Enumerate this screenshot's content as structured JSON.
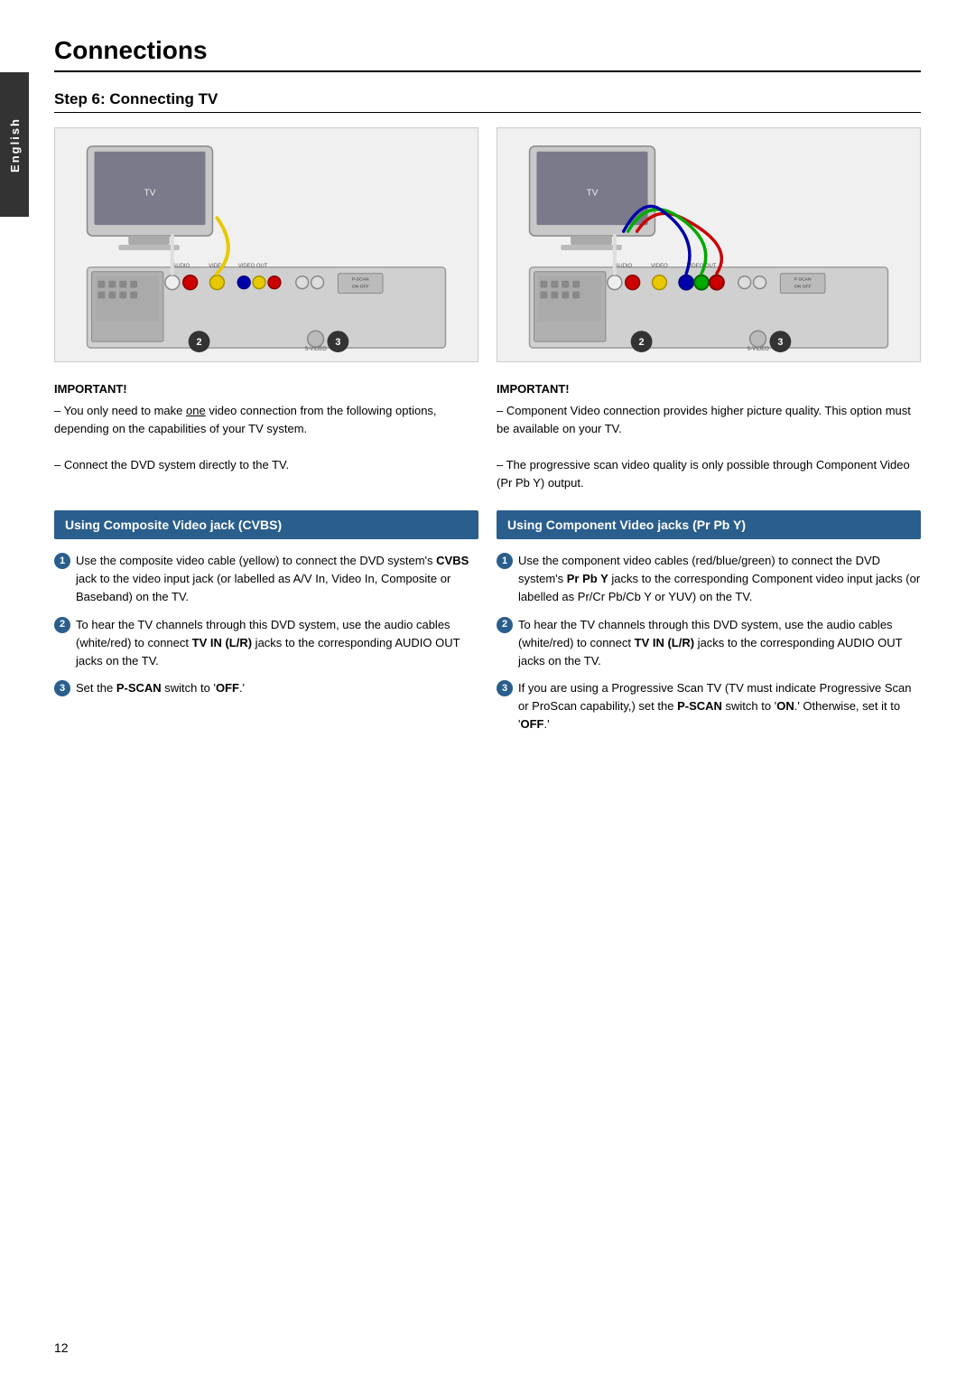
{
  "page": {
    "title": "Connections",
    "step": "Step 6:  Connecting TV",
    "sidebar_label": "English",
    "page_number": "12"
  },
  "important_left": {
    "label": "IMPORTANT!",
    "lines": [
      "– You only need to make one video connection from the following options, depending on the capabilities of your TV system.",
      "– Connect the DVD system directly to the TV."
    ]
  },
  "important_right": {
    "label": "IMPORTANT!",
    "lines": [
      "– Component Video connection provides higher picture quality. This option must be available on your TV.",
      "– The progressive scan video quality is only possible through Component Video (Pr Pb Y) output."
    ]
  },
  "section_left": {
    "header": "Using Composite Video jack (CVBS)",
    "instructions": [
      {
        "num": "1",
        "text": "Use the composite video cable (yellow) to connect the DVD system's CVBS jack to the video input jack (or labelled as A/V In, Video In, Composite or Baseband) on the TV."
      },
      {
        "num": "2",
        "text": "To hear the TV channels through this DVD system, use the audio cables (white/red) to connect TV IN (L/R) jacks to the corresponding AUDIO OUT jacks on the TV."
      },
      {
        "num": "3",
        "text": "Set the P-SCAN switch to 'OFF'."
      }
    ]
  },
  "section_right": {
    "header": "Using Component Video jacks (Pr Pb Y)",
    "instructions": [
      {
        "num": "1",
        "text": "Use the component video cables (red/blue/green) to connect the DVD system's Pr Pb Y jacks to the corresponding Component video input jacks (or labelled as Pr/Cr Pb/Cb Y or YUV) on the TV."
      },
      {
        "num": "2",
        "text": "To hear the TV channels through this DVD system, use the audio cables (white/red) to connect TV IN (L/R) jacks to the corresponding AUDIO OUT jacks on the TV."
      },
      {
        "num": "3",
        "text": "If you are using a Progressive Scan TV (TV must indicate Progressive Scan or ProScan capability,) set the P-SCAN switch to 'ON.' Otherwise, set it to 'OFF'."
      }
    ]
  }
}
